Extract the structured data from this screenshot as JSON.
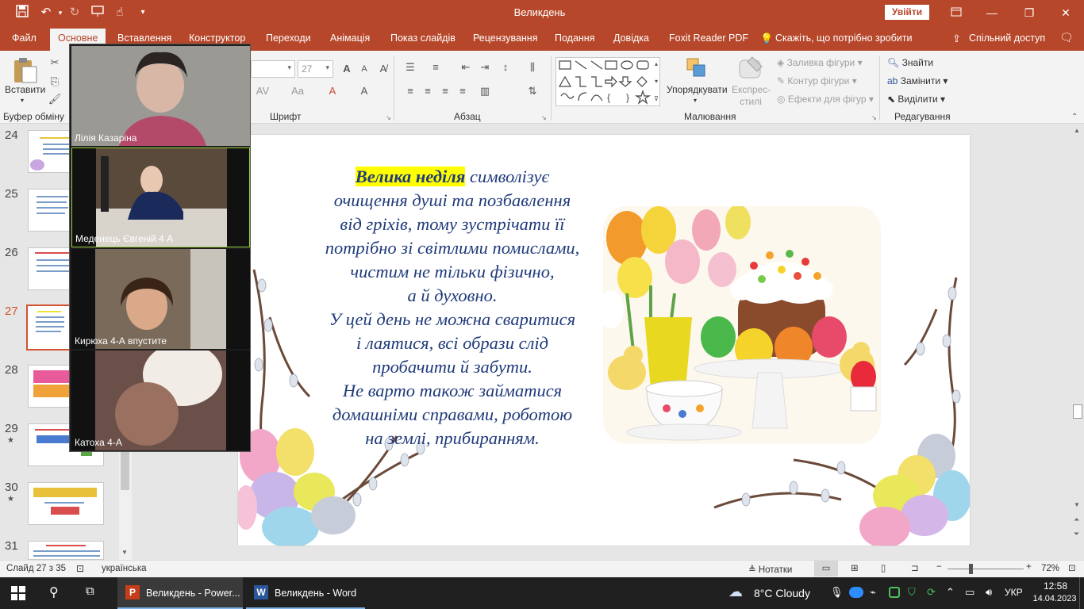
{
  "titlebar": {
    "doc_title": "Великдень",
    "signin_label": "Увійти",
    "icons": [
      "save-icon",
      "undo-icon",
      "redo-icon",
      "present-icon",
      "touch-mode-icon",
      "customize-icon"
    ]
  },
  "tabs": {
    "file": "Файл",
    "home": "Основне",
    "insert": "Вставлення",
    "design": "Конструктор",
    "transitions": "Переходи",
    "animations": "Анімація",
    "slideshow": "Показ слайдів",
    "review": "Рецензування",
    "view": "Подання",
    "help": "Довідка",
    "foxit": "Foxit Reader PDF",
    "tell_me": "Скажіть, що потрібно зробити",
    "share": "Спільний доступ"
  },
  "ribbon": {
    "clipboard": {
      "paste": "Вставити",
      "group": "Буфер обміну"
    },
    "font": {
      "font_size": "27",
      "group": "Шрифт"
    },
    "paragraph": {
      "group": "Абзац"
    },
    "drawing": {
      "arrange": "Упорядкувати",
      "quick_styles": "Експрес-стилі",
      "fill": "Заливка фігури",
      "outline": "Контур фігури",
      "effects": "Ефекти для фігур",
      "group": "Малювання"
    },
    "editing": {
      "find": "Знайти",
      "replace": "Замінити",
      "select": "Виділити",
      "group": "Редагування"
    }
  },
  "thumbnails": [
    {
      "number": "24",
      "star": ""
    },
    {
      "number": "25",
      "star": ""
    },
    {
      "number": "26",
      "star": ""
    },
    {
      "number": "27",
      "star": ""
    },
    {
      "number": "28",
      "star": ""
    },
    {
      "number": "29",
      "star": "★"
    },
    {
      "number": "30",
      "star": "★"
    },
    {
      "number": "31",
      "star": ""
    }
  ],
  "slide": {
    "highlight": "Велика неділя",
    "text_after_highlight": " символізує",
    "lines": [
      "очищення душі та позбавлення",
      "від гріхів, тому зустрічати її",
      "потрібно зі світлими помислами,",
      "чистим не тільки фізично,",
      "а й духовно.",
      "У цей день не можна сваритися",
      "і лаятися, всі образи слід",
      "пробачити й забути.",
      "Не варто також займатися",
      "домашніми справами, роботою",
      "на землі, прибиранням."
    ]
  },
  "zoom": {
    "participants": [
      {
        "name": "Лілія Казаріна"
      },
      {
        "name": "Меденець Євгеній 4 А"
      },
      {
        "name": "Кирюха 4-А впустите"
      },
      {
        "name": "Катоха 4-А"
      }
    ]
  },
  "statusbar": {
    "slide_info": "Слайд 27 з 35",
    "language": "українська",
    "notes": "Нотатки",
    "zoom": "72%"
  },
  "taskbar": {
    "apps": [
      {
        "label": "Великдень - Power..."
      },
      {
        "label": "Великдень - Word"
      }
    ],
    "weather": "8°C  Cloudy",
    "lang": "УКР",
    "time": "12:58",
    "date": "14.04.2023"
  },
  "colors": {
    "accent": "#b7472a",
    "selected_thumb": "#d35230",
    "slide_text": "#1f3a7a",
    "highlight": "#ffff00"
  }
}
